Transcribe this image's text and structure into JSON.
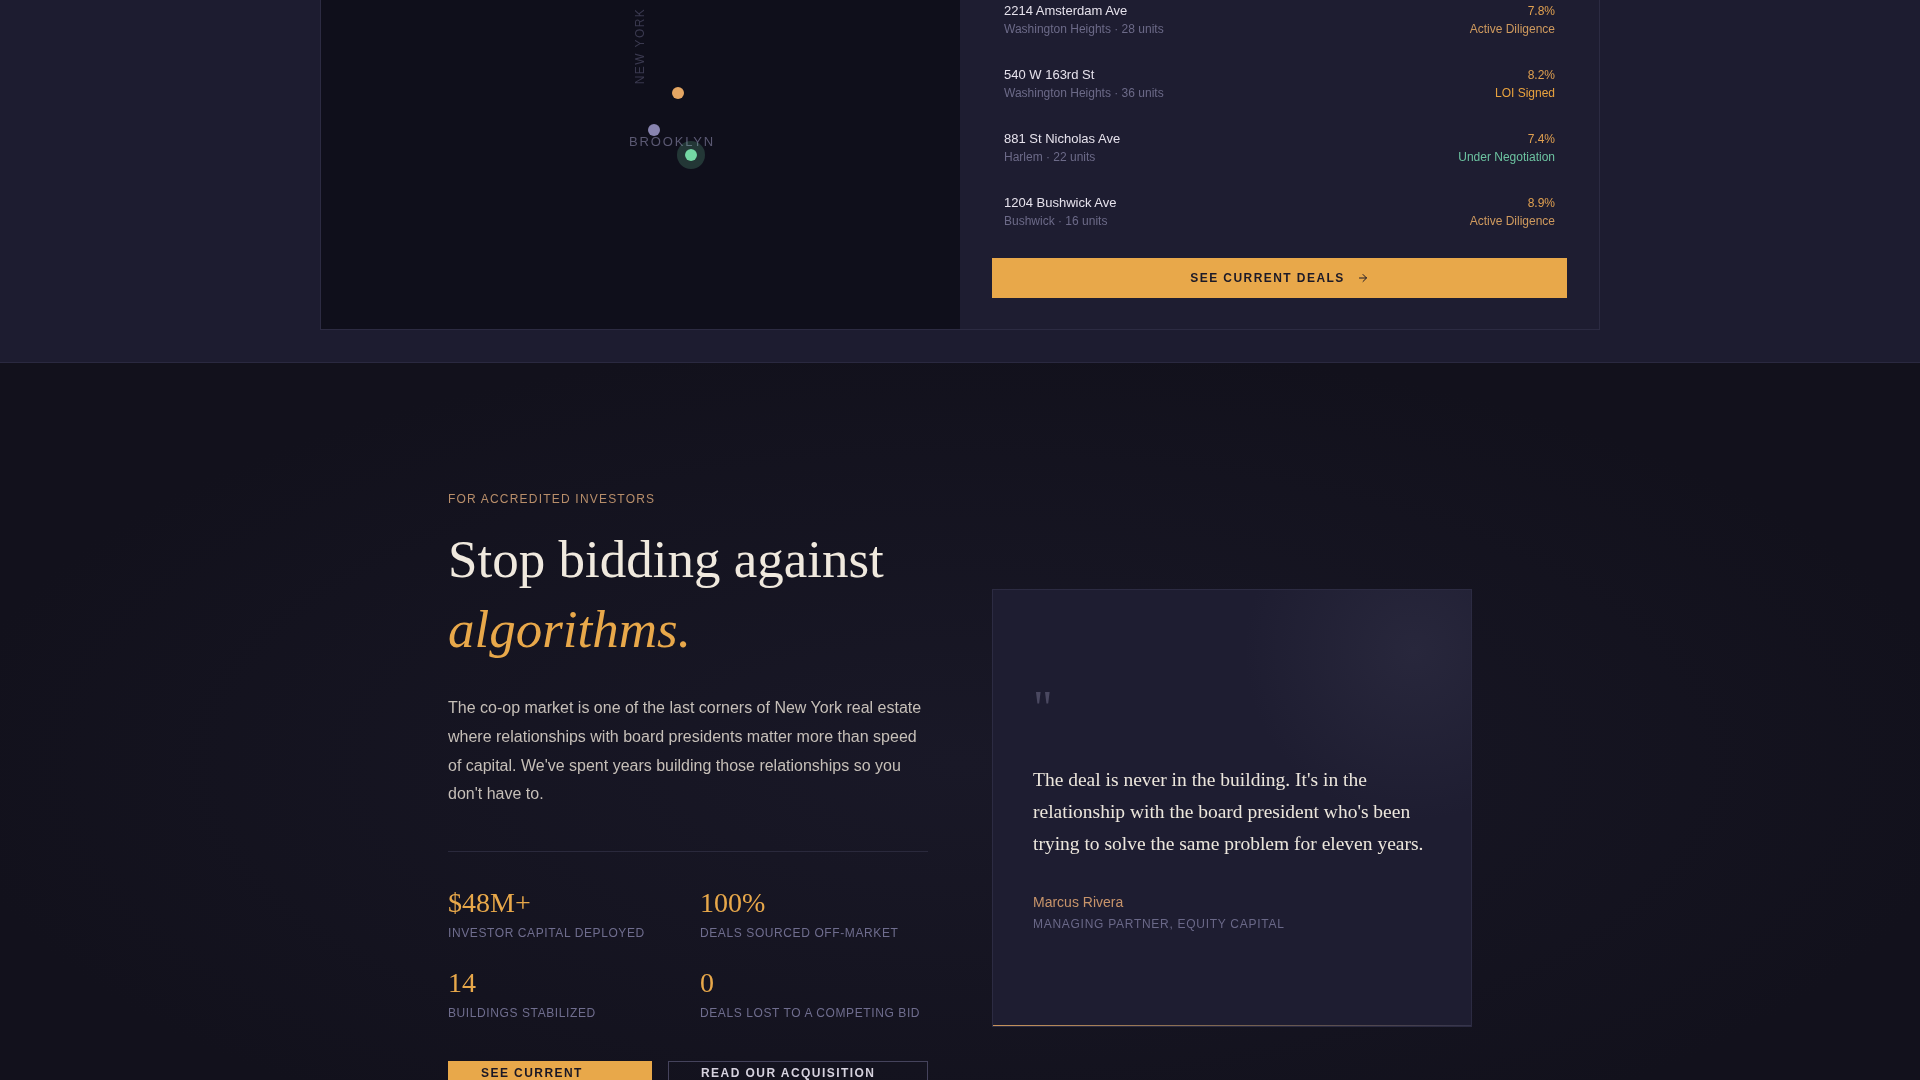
{
  "map": {
    "labels": [
      {
        "kind": "vertical",
        "text": "NEW YORK"
      },
      {
        "kind": "horizontal",
        "text": "BROOKLYN"
      }
    ],
    "pins": [
      {
        "color": "#e4a663",
        "selected": false
      },
      {
        "color": "#8884b0",
        "selected": false
      },
      {
        "color": "#74d9a4",
        "selected": true
      }
    ]
  },
  "deals": {
    "items": [
      {
        "address": "2214 Amsterdam Ave",
        "location": "Washington Heights · 28 units",
        "yield": "7.8%",
        "status": "Active Diligence",
        "color": "#cf9a5e"
      },
      {
        "address": "540 W 163rd St",
        "location": "Washington Heights · 36 units",
        "yield": "8.2%",
        "status": "LOI Signed",
        "color": "#e8a23e"
      },
      {
        "address": "881 St Nicholas Ave",
        "location": "Harlem · 22 units",
        "yield": "7.4%",
        "status": "Under Negotiation",
        "color": "#6cc2a0"
      },
      {
        "address": "1204 Bushwick Ave",
        "location": "Bushwick · 16 units",
        "yield": "8.9%",
        "status": "Active Diligence",
        "color": "#cf9a5e"
      }
    ],
    "button": "SEE CURRENT DEALS"
  },
  "investors": {
    "eyebrow": "FOR ACCREDITED INVESTORS",
    "headline": "Stop bidding against *algorithms.*",
    "body": "The co-op market is one of the last corners of New York real estate where relationships with board presidents matter more than speed of capital. We've spent years building those relationships so you don't have to.",
    "stats": [
      {
        "value": "$48M+",
        "label": "INVESTOR CAPITAL DEPLOYED"
      },
      {
        "value": "100%",
        "label": "DEALS SOURCED OFF-MARKET"
      },
      {
        "value": "14",
        "label": "BUILDINGS STABILIZED"
      },
      {
        "value": "0",
        "label": "DEALS LOST TO A COMPETING BID"
      }
    ],
    "buttons": [
      {
        "kind": "primary",
        "label": "SEE CURRENT"
      },
      {
        "kind": "secondary",
        "label": "READ OUR ACQUISITION"
      }
    ]
  },
  "testimonial": {
    "quote_mark": "\"",
    "quote": "The deal is never in the building. It's in the relationship with the board president who's been trying to solve the same problem for eleven years.",
    "author": "Marcus Rivera",
    "role": "MANAGING PARTNER, EQUITY CAPITAL"
  }
}
